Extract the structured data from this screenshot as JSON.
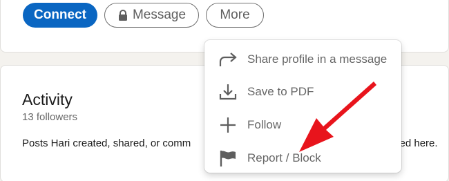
{
  "profile_actions": {
    "connect_label": "Connect",
    "message_label": "Message",
    "more_label": "More",
    "primary_color": "#0a66c2"
  },
  "activity": {
    "title": "Activity",
    "followers": "13 followers",
    "posts_text_start": "Posts Hari created, shared, or comm",
    "posts_text_end": "ved here."
  },
  "more_menu": {
    "items": [
      {
        "label": "Share profile in a message",
        "icon": "share-arrow-icon"
      },
      {
        "label": "Save to PDF",
        "icon": "download-icon"
      },
      {
        "label": "Follow",
        "icon": "plus-icon"
      },
      {
        "label": "Report / Block",
        "icon": "flag-icon"
      }
    ]
  },
  "annotation": {
    "arrow_color": "#e8141c",
    "icon": "red-arrow-icon"
  }
}
